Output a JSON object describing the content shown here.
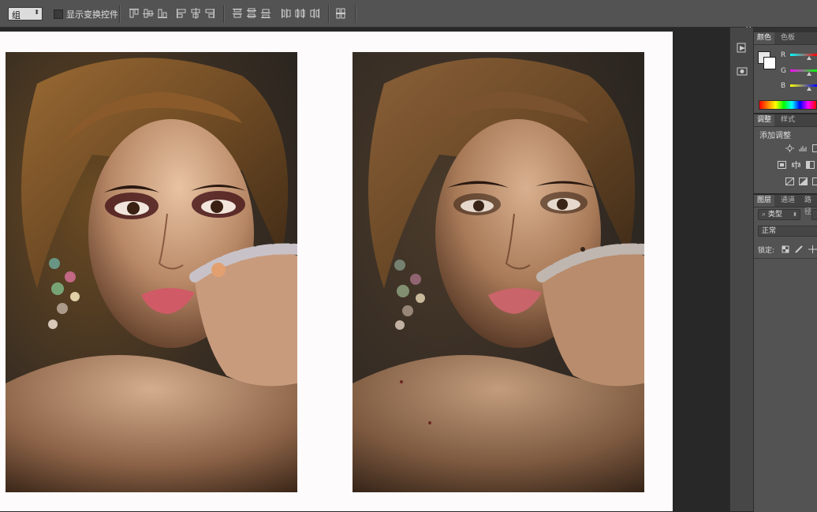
{
  "options_bar": {
    "auto_select_value": "组",
    "show_transform_controls_label": "显示变换控件"
  },
  "canvas": {
    "photo_left_label": "",
    "photo_right_label": ""
  },
  "panels": {
    "color_tabs": [
      "颜色",
      "色板"
    ],
    "rgb_labels": [
      "R",
      "G",
      "B"
    ],
    "adjust_tabs": [
      "调整",
      "样式"
    ],
    "add_adjustment_label": "添加调整",
    "layers_tabs": [
      "图层",
      "通道",
      "路径"
    ],
    "layer_filter_value": "类型",
    "blend_mode_value": "正常",
    "lock_label": "锁定:"
  },
  "icons": [
    "align-top-edges-icon",
    "align-vertical-centers-icon",
    "align-bottom-edges-icon",
    "align-left-edges-icon",
    "align-horizontal-centers-icon",
    "align-right-edges-icon",
    "distribute-top-icon",
    "distribute-vcenter-icon",
    "distribute-bottom-icon",
    "distribute-left-icon",
    "distribute-hcenter-icon",
    "distribute-right-icon",
    "auto-align-icon",
    "history-icon",
    "3d-icon"
  ],
  "colors": {
    "ui_panel": "#535353",
    "ui_dark": "#282828",
    "canvas_white": "#fdfbfc"
  }
}
